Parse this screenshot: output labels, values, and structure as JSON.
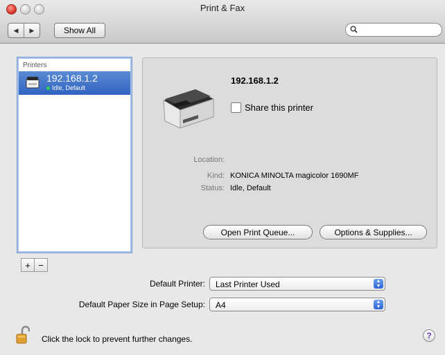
{
  "window": {
    "title": "Print & Fax",
    "show_all_label": "Show All",
    "search_placeholder": ""
  },
  "printers": {
    "header": "Printers",
    "items": [
      {
        "name": "192.168.1.2",
        "status": "Idle, Default"
      }
    ]
  },
  "details": {
    "name": "192.168.1.2",
    "share_label": "Share this printer",
    "share_checked": false,
    "location_key": "Location:",
    "location_value": "",
    "kind_key": "Kind:",
    "kind_value": "KONICA MINOLTA magicolor 1690MF",
    "status_key": "Status:",
    "status_value": "Idle, Default",
    "open_queue_label": "Open Print Queue...",
    "options_label": "Options & Supplies..."
  },
  "list_controls": {
    "add": "+",
    "remove": "−"
  },
  "defaults": {
    "default_printer_label": "Default Printer:",
    "default_printer_value": "Last Printer Used",
    "paper_size_label": "Default Paper Size in Page Setup:",
    "paper_size_value": "A4"
  },
  "footer": {
    "lock_text": "Click the lock to prevent further changes.",
    "help": "?"
  },
  "icons": {
    "back": "back-arrow-icon",
    "forward": "forward-arrow-icon",
    "search": "search-icon",
    "lock": "lock-icon",
    "help": "help-icon",
    "printer": "printer-icon"
  },
  "colors": {
    "selection": "#2f63c0",
    "close_button": "#d93a2b",
    "status_dot": "#2bd24a"
  }
}
